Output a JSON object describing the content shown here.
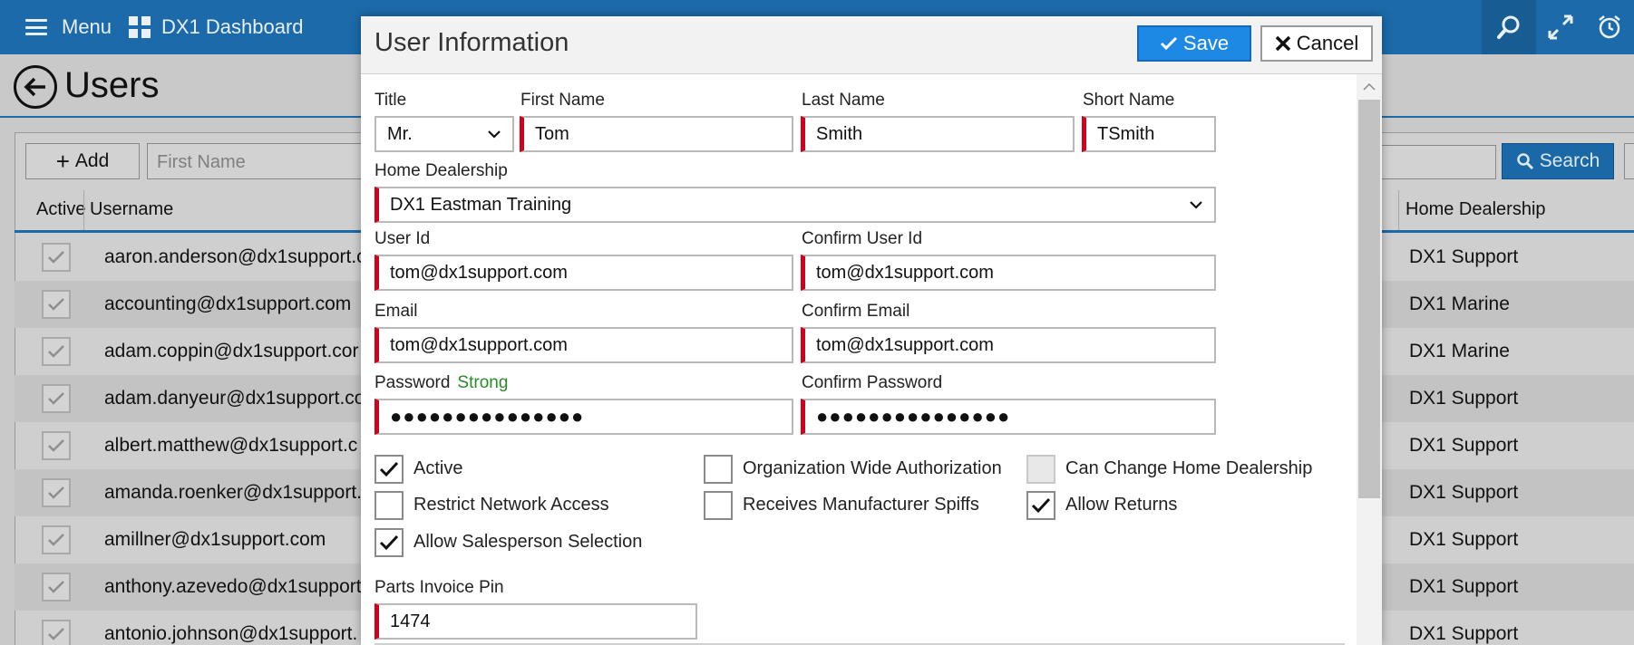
{
  "topbar": {
    "menu_label": "Menu",
    "dashboard_label": "DX1 Dashboard"
  },
  "page": {
    "title": "Users",
    "add_label": "Add",
    "first_name_placeholder": "First Name",
    "search_label": "Search",
    "columns": {
      "active": "Active",
      "username": "Username",
      "home": "Home Dealership"
    },
    "rows": [
      {
        "username": "aaron.anderson@dx1support.c",
        "home": "DX1 Support"
      },
      {
        "username": "accounting@dx1support.com",
        "home": "DX1 Marine"
      },
      {
        "username": "adam.coppin@dx1support.cor",
        "home": "DX1 Marine"
      },
      {
        "username": "adam.danyeur@dx1support.co",
        "home": "DX1 Support"
      },
      {
        "username": "albert.matthew@dx1support.c",
        "home": "DX1 Support"
      },
      {
        "username": "amanda.roenker@dx1support.",
        "home": "DX1 Support"
      },
      {
        "username": "amillner@dx1support.com",
        "home": "DX1 Support"
      },
      {
        "username": "anthony.azevedo@dx1support",
        "home": "DX1 Support"
      },
      {
        "username": "antonio.johnson@dx1support.",
        "home": "DX1 Support"
      }
    ]
  },
  "modal": {
    "title": "User Information",
    "save_label": "Save",
    "cancel_label": "Cancel",
    "labels": {
      "title": "Title",
      "first_name": "First Name",
      "last_name": "Last Name",
      "short_name": "Short Name",
      "home_dealership": "Home Dealership",
      "user_id": "User Id",
      "confirm_user_id": "Confirm User Id",
      "email": "Email",
      "confirm_email": "Confirm Email",
      "password": "Password",
      "password_strength": "Strong",
      "confirm_password": "Confirm Password",
      "parts_invoice_pin": "Parts Invoice Pin"
    },
    "values": {
      "title": "Mr.",
      "first_name": "Tom",
      "last_name": "Smith",
      "short_name": "TSmith",
      "home_dealership": "DX1 Eastman Training",
      "user_id": "tom@dx1support.com",
      "confirm_user_id": "tom@dx1support.com",
      "email": "tom@dx1support.com",
      "confirm_email": "tom@dx1support.com",
      "password": "●●●●●●●●●●●●●●●",
      "confirm_password": "●●●●●●●●●●●●●●●",
      "parts_invoice_pin": "1474"
    },
    "checkboxes": {
      "active": "Active",
      "org_wide": "Organization Wide Authorization",
      "change_home": "Can Change Home Dealership",
      "restrict_network": "Restrict Network Access",
      "manufacturer_spiffs": "Receives Manufacturer Spiffs",
      "allow_returns": "Allow Returns",
      "salesperson_selection": "Allow Salesperson Selection"
    }
  },
  "colors": {
    "brand": "#1c6aa9",
    "save": "#1e88e5",
    "required": "#d0021b",
    "strong": "#2a8a2a"
  },
  "icons": [
    "hamburger-icon",
    "dashboard-grid-icon",
    "search-icon",
    "expand-icon",
    "alarm-clock-icon",
    "back-arrow-icon",
    "plus-icon",
    "check-icon",
    "close-icon",
    "chevron-down-icon",
    "chevron-up-icon"
  ]
}
